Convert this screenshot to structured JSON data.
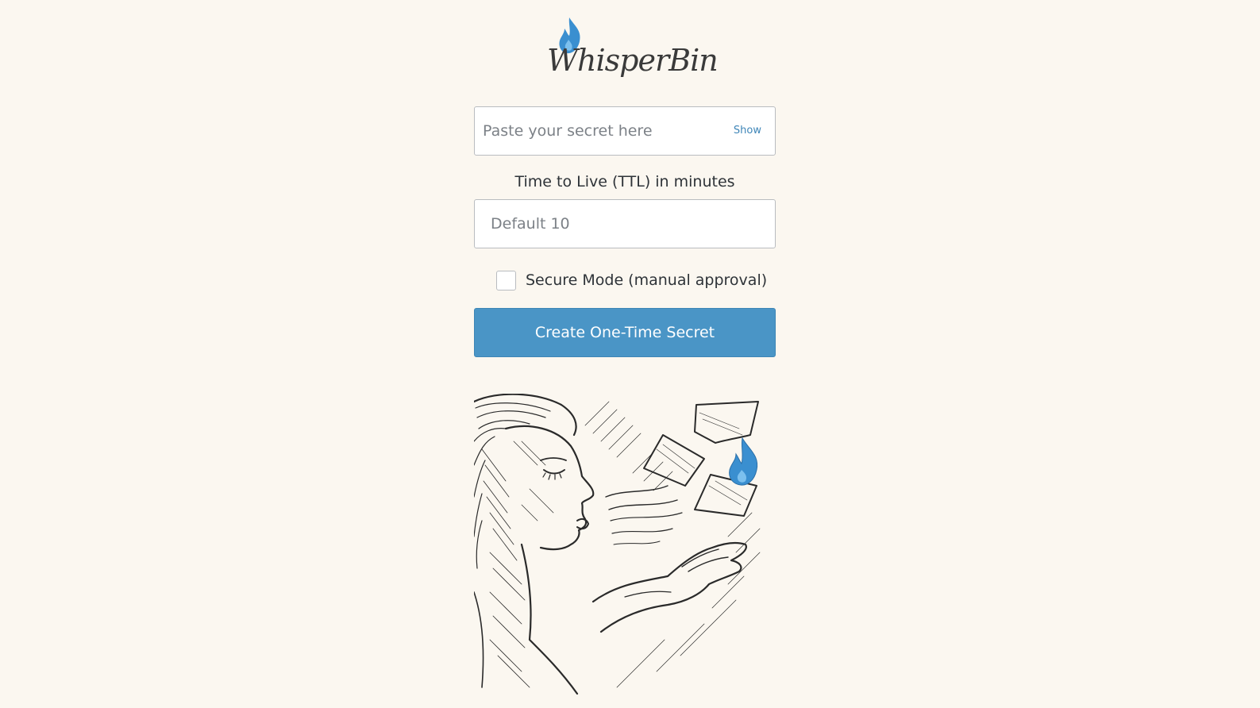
{
  "brand": {
    "logo_text": "WhisperBin",
    "accent_color": "#4a95c6"
  },
  "secret_input": {
    "placeholder": "Paste your secret here",
    "value": "",
    "show_label": "Show"
  },
  "ttl": {
    "label": "Time to Live (TTL) in minutes",
    "placeholder": "Default 10",
    "value": ""
  },
  "secure_mode": {
    "label": "Secure Mode (manual approval)",
    "checked": false
  },
  "create_button": {
    "label": "Create One-Time Secret"
  },
  "illustration": {
    "icon": "woman-blowing-papers-illustration",
    "flame_icon": "blue-flame-icon"
  }
}
